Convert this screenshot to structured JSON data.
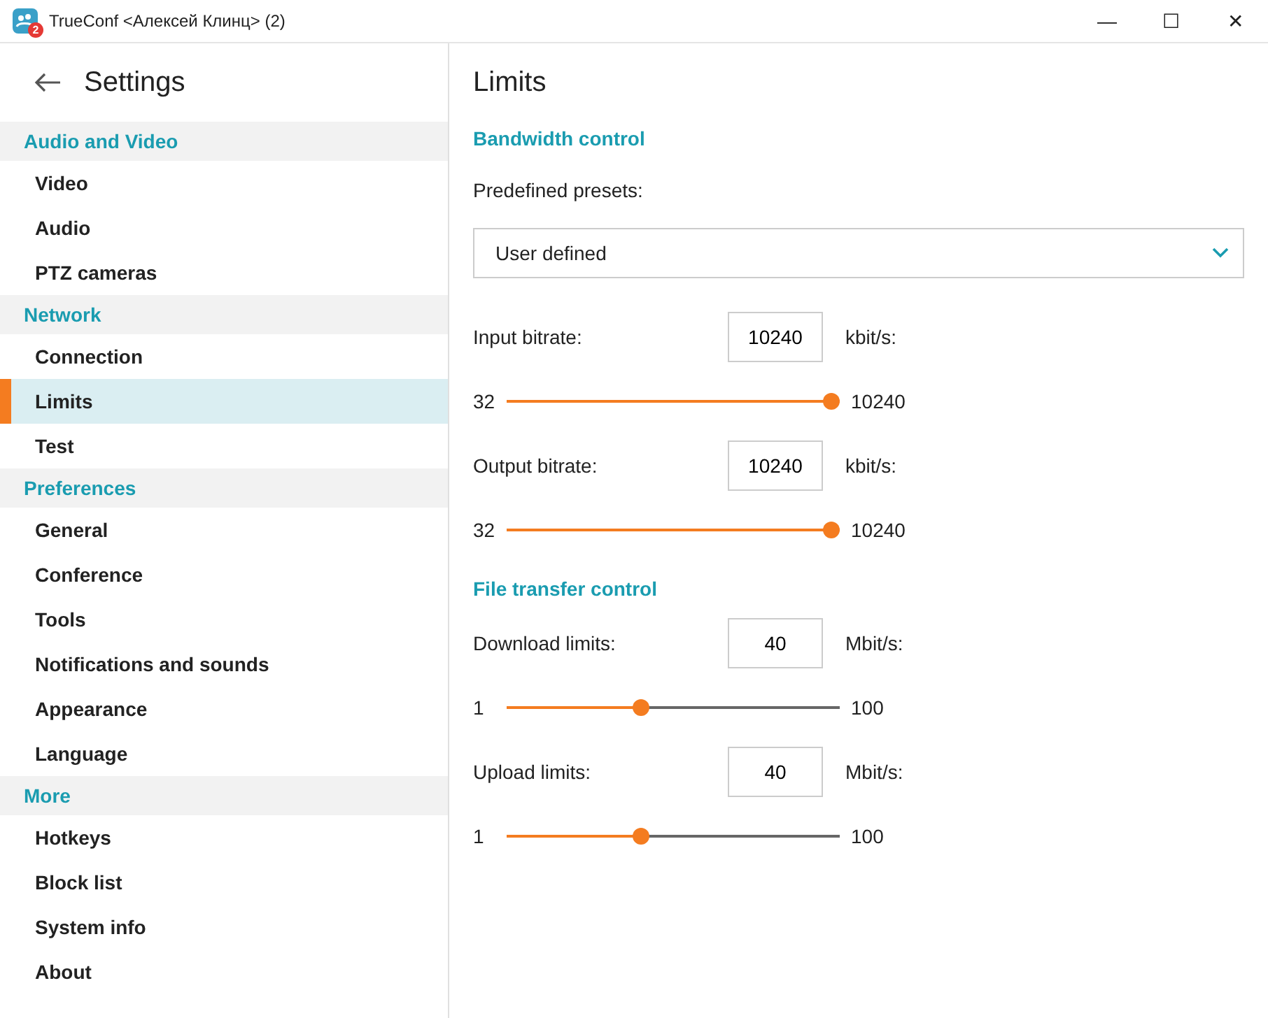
{
  "window": {
    "title": "TrueConf <Алексей Клинц> (2)",
    "badge": "2",
    "controls": [
      "—",
      "☐",
      "✕"
    ]
  },
  "sidebar": {
    "title": "Settings",
    "sections": [
      {
        "title": "Audio and Video",
        "items": [
          {
            "label": "Video",
            "selected": false
          },
          {
            "label": "Audio",
            "selected": false
          },
          {
            "label": "PTZ cameras",
            "selected": false
          }
        ]
      },
      {
        "title": "Network",
        "items": [
          {
            "label": "Connection",
            "selected": false
          },
          {
            "label": "Limits",
            "selected": true
          },
          {
            "label": "Test",
            "selected": false
          }
        ]
      },
      {
        "title": "Preferences",
        "items": [
          {
            "label": "General",
            "selected": false
          },
          {
            "label": "Conference",
            "selected": false
          },
          {
            "label": "Tools",
            "selected": false
          },
          {
            "label": "Notifications and sounds",
            "selected": false
          },
          {
            "label": "Appearance",
            "selected": false
          },
          {
            "label": "Language",
            "selected": false
          }
        ]
      },
      {
        "title": "More",
        "items": [
          {
            "label": "Hotkeys",
            "selected": false
          },
          {
            "label": "Block list",
            "selected": false
          },
          {
            "label": "System info",
            "selected": false
          },
          {
            "label": "About",
            "selected": false
          }
        ]
      }
    ]
  },
  "content": {
    "title": "Limits",
    "groups": [
      {
        "title": "Bandwidth control",
        "preset": {
          "label": "Predefined presets:",
          "value": "User defined"
        },
        "rows": [
          {
            "label": "Input bitrate:",
            "value": "10240",
            "unit": "kbit/s:",
            "min": "32",
            "max": "10240",
            "level": 1.0
          },
          {
            "label": "Output bitrate:",
            "value": "10240",
            "unit": "kbit/s:",
            "min": "32",
            "max": "10240",
            "level": 1.0
          }
        ]
      },
      {
        "title": "File transfer control",
        "rows": [
          {
            "label": "Download limits:",
            "value": "40",
            "unit": "Mbit/s:",
            "min": "1",
            "max": "100",
            "level": 0.4
          },
          {
            "label": "Upload limits:",
            "value": "40",
            "unit": "Mbit/s:",
            "min": "1",
            "max": "100",
            "level": 0.4
          }
        ]
      }
    ]
  }
}
